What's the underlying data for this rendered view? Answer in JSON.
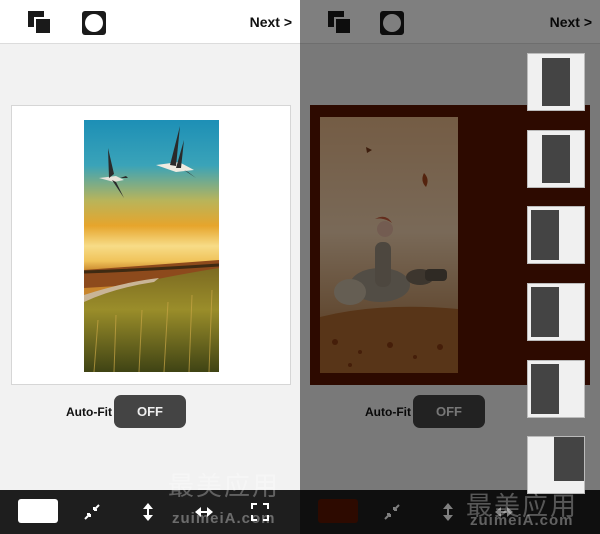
{
  "left_panel": {
    "topbar": {
      "next_label": "Next >"
    },
    "autofit": {
      "label": "Auto-Fit",
      "toggle_value": "OFF"
    },
    "bottombar": {
      "swatch_color": "#ffffff"
    },
    "watermark": {
      "cn": "最美应用",
      "en": "zuimeiA.com"
    }
  },
  "right_panel": {
    "topbar": {
      "next_label": "Next >"
    },
    "canvas_color": "#5a1500",
    "autofit": {
      "label": "Auto-Fit",
      "toggle_value": "OFF"
    },
    "layout_options": [
      "layout-1",
      "layout-2",
      "layout-3",
      "layout-4",
      "layout-5",
      "layout-6"
    ],
    "watermark": {
      "cn": "最美应用",
      "en": "zuimeiA.com"
    }
  }
}
